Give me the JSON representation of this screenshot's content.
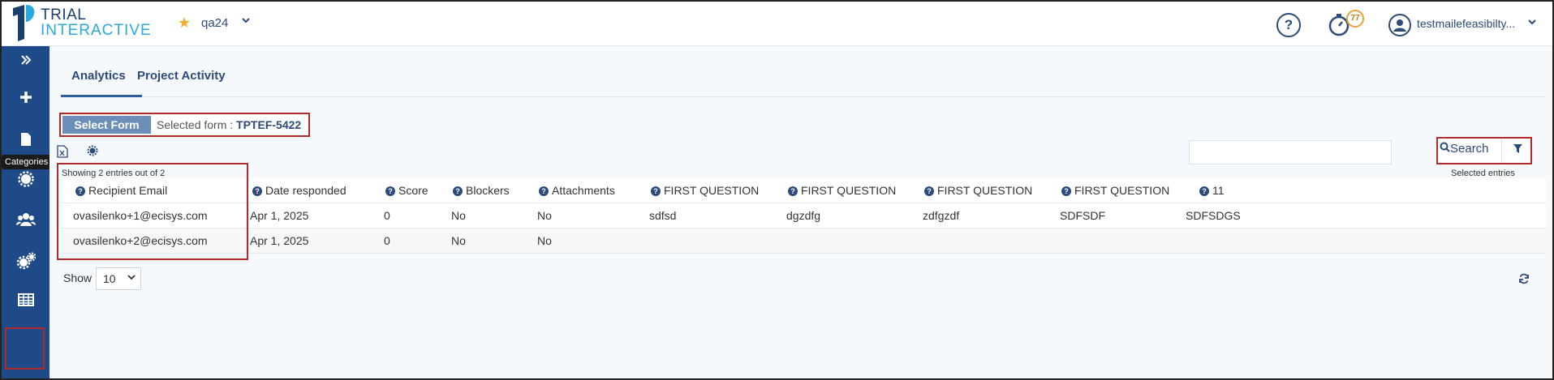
{
  "header": {
    "logo_line1": "TRIAL",
    "logo_line2": "INTERACTIVE",
    "project": "qa24",
    "timer_badge": "77",
    "user_name": "testmailefeasibilty..."
  },
  "sidebar": {
    "tooltip": "Categories",
    "items": [
      "expand-icon",
      "plus-icon",
      "document-icon",
      "gear-icon",
      "users-icon",
      "cogs-icon",
      "table-icon"
    ]
  },
  "tabs": [
    {
      "label": "Analytics",
      "active": true
    },
    {
      "label": "Project Activity",
      "active": false
    }
  ],
  "form": {
    "select_button": "Select Form",
    "selected_label": "Selected form : ",
    "selected_value": "TPTEF-5422"
  },
  "search": {
    "button": "Search",
    "placeholder": ""
  },
  "info": {
    "showing": "Showing 2 entries out of 2",
    "selected_entries": "Selected entries"
  },
  "table": {
    "columns": [
      "Recipient Email",
      "Date responded",
      "Score",
      "Blockers",
      "Attachments",
      "FIRST QUESTION",
      "FIRST QUESTION",
      "FIRST QUESTION",
      "FIRST QUESTION",
      "11"
    ],
    "rows": [
      [
        "ovasilenko+1@ecisys.com",
        "Apr 1, 2025",
        "0",
        "No",
        "No",
        "sdfsd",
        "dgzdfg",
        "zdfgzdf",
        "SDFSDF",
        "SDFSDGS"
      ],
      [
        "ovasilenko+2@ecisys.com",
        "Apr 1, 2025",
        "0",
        "No",
        "No",
        "",
        "",
        "",
        "",
        ""
      ]
    ]
  },
  "pagination": {
    "show_label": "Show",
    "page_size": "10"
  },
  "colors": {
    "sidebar": "#1e4a87",
    "accent": "#2c4a7a",
    "highlight": "#b02a2a"
  }
}
